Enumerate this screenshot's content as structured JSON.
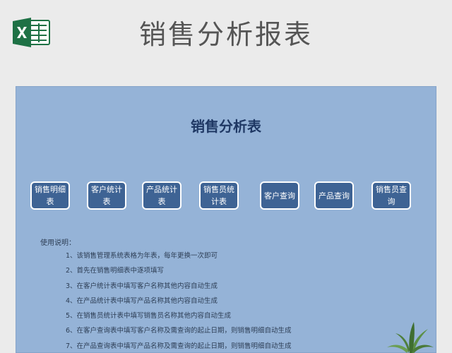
{
  "header": {
    "title": "销售分析报表",
    "icon": "excel-icon",
    "icon_color": "#1e7145"
  },
  "sheet": {
    "title": "销售分析表",
    "background": "#95b3d7",
    "nav_buttons": [
      {
        "label": "销售明细表"
      },
      {
        "label": "客户统计表"
      },
      {
        "label": "产品统计表"
      },
      {
        "label": "销售员统计表"
      },
      {
        "label": "客户查询"
      },
      {
        "label": "产品查询"
      },
      {
        "label": "销售员查询"
      }
    ],
    "instructions_label": "使用说明：",
    "instructions": [
      "1、该销售管理系统表格为年表，每年更换一次即可",
      "2、首先在销售明细表中逐项填写",
      "3、在客户统计表中填写客户名称其他内容自动生成",
      "4、在产品统计表中填写产品名称其他内容自动生成",
      "5、在销售员统计表中填写销售员名称其他内容自动生成",
      "6、在客户查询表中填写客户名称及需查询的起止日期，则销售明细自动生成",
      "7、在产品查询表中填写产品名称及需查询的起止日期，则销售明细自动生成"
    ]
  }
}
